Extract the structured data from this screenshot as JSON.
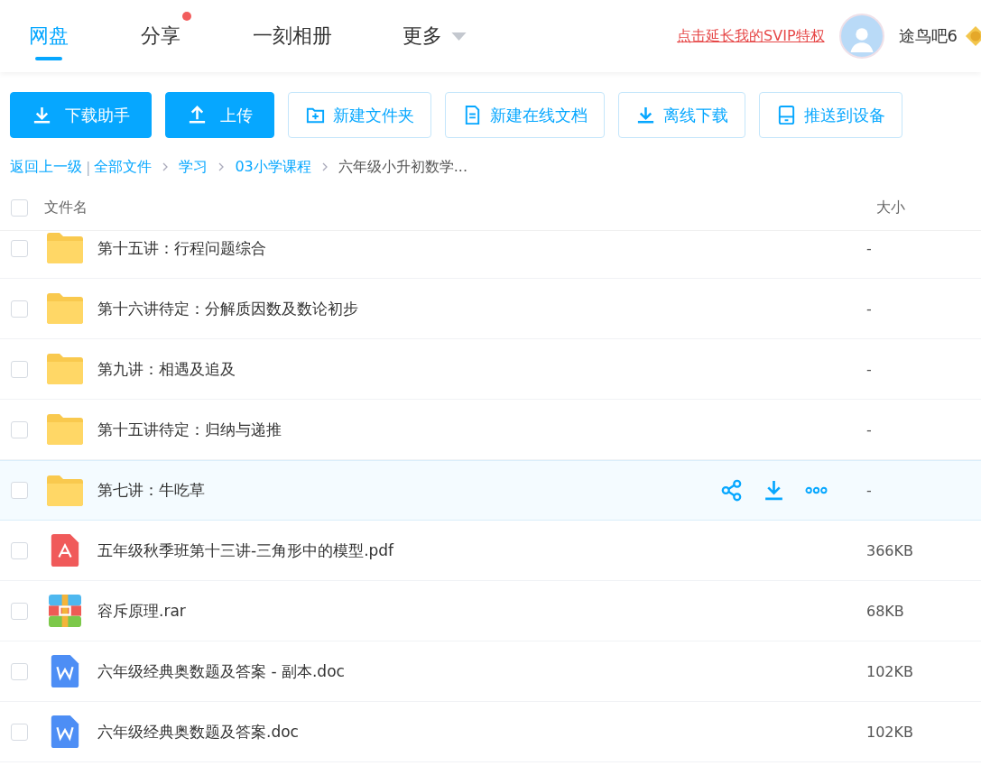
{
  "nav": {
    "tabs": [
      {
        "label": "网盘",
        "selected": true,
        "dot": false,
        "caret": false
      },
      {
        "label": "分享",
        "selected": false,
        "dot": true,
        "caret": false
      },
      {
        "label": "一刻相册",
        "selected": false,
        "dot": false,
        "caret": false
      },
      {
        "label": "更多",
        "selected": false,
        "dot": false,
        "caret": true
      }
    ],
    "promo_link": "点击延长我的SVIP特权",
    "username": "途鸟吧6"
  },
  "toolbar": [
    {
      "label": "下载助手",
      "kind": "primary"
    },
    {
      "label": "上传",
      "kind": "primary"
    },
    {
      "label": "新建文件夹",
      "kind": "plain"
    },
    {
      "label": "新建在线文档",
      "kind": "plain"
    },
    {
      "label": "离线下载",
      "kind": "plain"
    },
    {
      "label": "推送到设备",
      "kind": "plain"
    }
  ],
  "breadcrumb": {
    "back": "返回上一级",
    "separator": "|",
    "items": [
      "全部文件",
      "学习",
      "03小学课程"
    ],
    "current": "六年级小升初数学..."
  },
  "table": {
    "select_all_checked": false,
    "columns": [
      "文件名",
      "大小"
    ],
    "rows": [
      {
        "name": "第十五讲：行程问题综合",
        "size": "-",
        "kind": "folder",
        "hovered": false,
        "checked": false
      },
      {
        "name": "第十六讲待定：分解质因数及数论初步",
        "size": "-",
        "kind": "folder",
        "hovered": false,
        "checked": false
      },
      {
        "name": "第九讲：相遇及追及",
        "size": "-",
        "kind": "folder",
        "hovered": false,
        "checked": false
      },
      {
        "name": "第十五讲待定：归纳与递推",
        "size": "-",
        "kind": "folder",
        "hovered": false,
        "checked": false
      },
      {
        "name": "第七讲：牛吃草",
        "size": "-",
        "kind": "folder",
        "hovered": true,
        "checked": false
      },
      {
        "name": "五年级秋季班第十三讲-三角形中的模型.pdf",
        "size": "366KB",
        "kind": "pdf",
        "hovered": false,
        "checked": false
      },
      {
        "name": "容斥原理.rar",
        "size": "68KB",
        "kind": "rar",
        "hovered": false,
        "checked": false
      },
      {
        "name": "六年级经典奥数题及答案 - 副本.doc",
        "size": "102KB",
        "kind": "doc",
        "hovered": false,
        "checked": false
      },
      {
        "name": "六年级经典奥数题及答案.doc",
        "size": "102KB",
        "kind": "doc",
        "hovered": false,
        "checked": false
      }
    ]
  }
}
